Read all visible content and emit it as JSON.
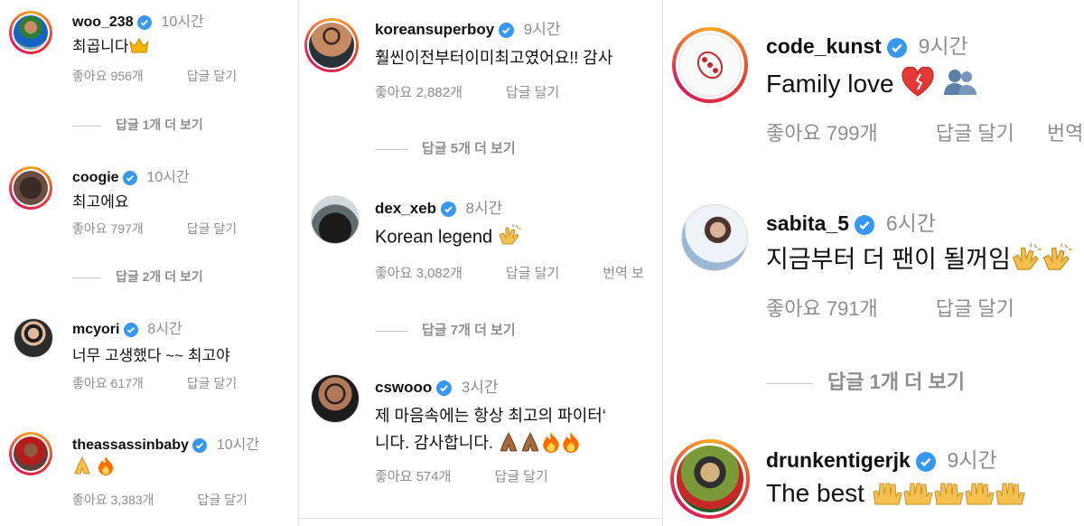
{
  "panel1": {
    "comments": [
      {
        "user": "woo_238",
        "time": "10시간",
        "text": "최곱니다",
        "emoji": "crown",
        "likes": "좋아요 956개",
        "reply": "답글 달기"
      },
      {
        "user": "coogie",
        "time": "10시간",
        "text": "최고에요",
        "likes": "좋아요 797개",
        "reply": "답글 달기"
      },
      {
        "user": "mcyori",
        "time": "8시간",
        "text": "너무 고생했다 ~~ 최고야",
        "likes": "좋아요 617개",
        "reply": "답글 달기"
      },
      {
        "user": "theassassinbaby",
        "time": "10시간",
        "text": "",
        "emoji": "pray fire",
        "likes": "좋아요 3,383개",
        "reply": "답글 달기"
      }
    ],
    "more": [
      "답글 1개 더 보기",
      "답글 2개 더 보기"
    ]
  },
  "panel2": {
    "comments": [
      {
        "user": "koreansuperboy",
        "time": "9시간",
        "text": "훨씬이전부터이미최고였어요!! 감사",
        "likes": "좋아요 2,882개",
        "reply": "답글 달기"
      },
      {
        "user": "dex_xeb",
        "time": "8시간",
        "text": "Korean legend",
        "emoji": "clap",
        "likes": "좋아요 3,082개",
        "reply": "답글 달기",
        "translate": "번역 보"
      },
      {
        "user": "cswooo",
        "time": "3시간",
        "text": "제 마음속에는 항상 최고의 파이터‘",
        "text2": "니다. 감사합니다.",
        "emoji": "pray pray fire fire",
        "likes": "좋아요 574개",
        "reply": "답글 달기"
      }
    ],
    "more": [
      "답글 5개 더 보기",
      "답글 7개 더 보기"
    ]
  },
  "panel3": {
    "comments": [
      {
        "user": "code_kunst",
        "time": "9시간",
        "text": "Family love",
        "emoji": "heart people",
        "likes": "좋아요 799개",
        "reply": "답글 달기",
        "translate": "번역"
      },
      {
        "user": "sabita_5",
        "time": "6시간",
        "text": "지금부터 더 팬이 될꺼임",
        "emoji": "clap clap",
        "likes": "좋아요 791개",
        "reply": "답글 달기"
      },
      {
        "user": "drunkentigerjk",
        "time": "9시간",
        "text": "The best",
        "emoji": "raise x6"
      }
    ],
    "more": [
      "답글 1개 더 보기"
    ]
  },
  "colors": {
    "verified": "#3897f0",
    "muted": "#8e8e8e",
    "text": "#111111",
    "ring": "#e1306c"
  }
}
